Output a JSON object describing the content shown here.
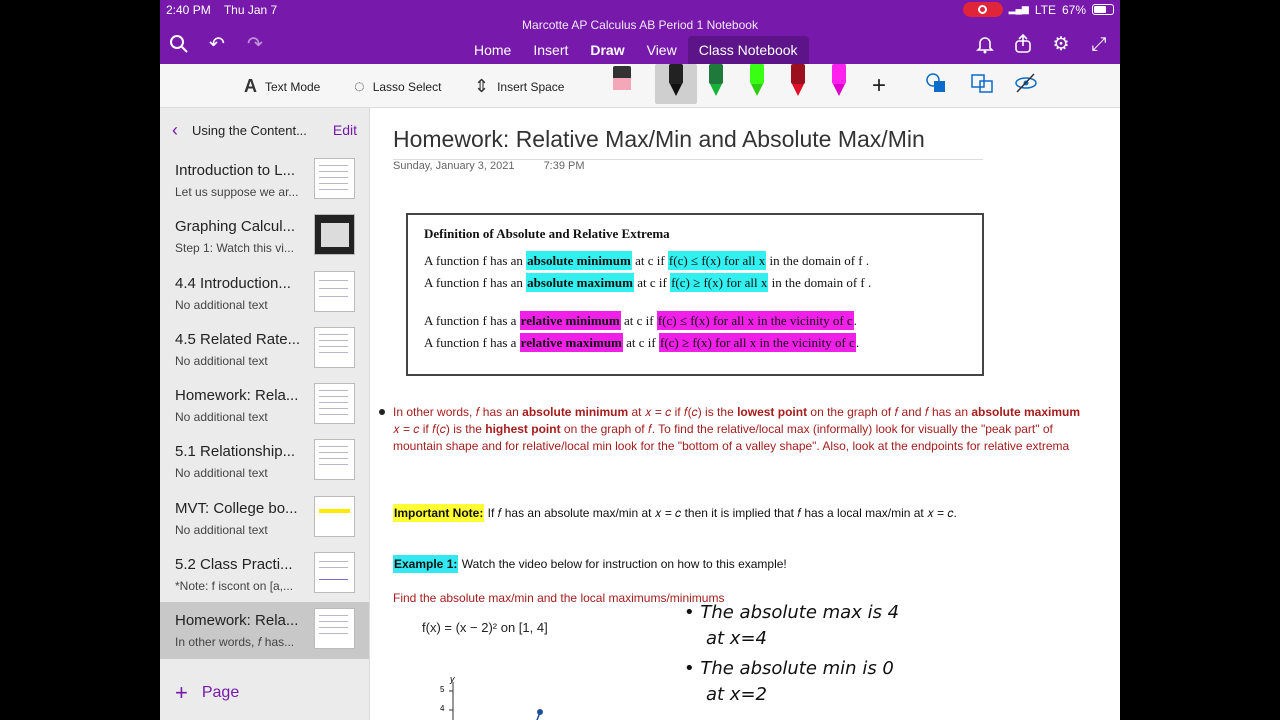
{
  "status": {
    "time": "2:40 PM",
    "date": "Thu Jan 7",
    "network": "LTE",
    "battery": "67%"
  },
  "app": {
    "notebook_title": "Marcotte AP Calculus AB Period 1 Notebook"
  },
  "tabs": [
    "Home",
    "Insert",
    "Draw",
    "View",
    "Class Notebook"
  ],
  "ribbon": {
    "text_mode": "Text Mode",
    "lasso": "Lasso Select",
    "insert_space": "Insert Space"
  },
  "sidebar": {
    "section": "Using the Content...",
    "edit": "Edit",
    "add_page": "Page",
    "items": [
      {
        "title": "Introduction to L...",
        "sub": "Let us suppose we ar..."
      },
      {
        "title": "Graphing Calcul...",
        "sub": "Step 1: Watch this vi..."
      },
      {
        "title": "4.4 Introduction...",
        "sub": "No additional text"
      },
      {
        "title": "4.5 Related Rate...",
        "sub": "No additional text"
      },
      {
        "title": "Homework: Rela...",
        "sub": "No additional text"
      },
      {
        "title": "5.1 Relationship...",
        "sub": "No additional text"
      },
      {
        "title": "MVT: College bo...",
        "sub": "No additional text"
      },
      {
        "title": "5.2 Class Practi...",
        "sub": "*Note: f iscont on [a,..."
      },
      {
        "title": "Homework: Rela...",
        "sub": "In other words, 𝑓 has..."
      }
    ]
  },
  "page": {
    "title": "Homework: Relative Max/Min and Absolute Max/Min",
    "date": "Sunday, January 3, 2021",
    "time": "7:39 PM",
    "def_heading": "Definition of Absolute and Relative Extrema",
    "def": {
      "l1a": "A function  f  has an ",
      "l1b": "absolute minimum",
      "l1c": " at  c  if ",
      "l1d": "f(c) ≤ f(x)  for all  x",
      "l1e": " in the domain of  f .",
      "l2a": "A function  f  has an ",
      "l2b": "absolute maximum",
      "l2c": " at  c  if ",
      "l2d": "f(c) ≥ f(x)  for all  x",
      "l2e": " in the domain of  f .",
      "l3a": "A function  f  has a ",
      "l3b": "relative minimum",
      "l3c": " at  c  if ",
      "l3d": "f(c) ≤ f(x)  for all  x in the vicinity of  c",
      "l3e": ".",
      "l4a": "A function  f  has a ",
      "l4b": "relative maximum",
      "l4c": " at  c  if ",
      "l4d": "f(c) ≥ f(x)  for all  x in the vicinity of  c",
      "l4e": "."
    },
    "para1": "In other words, 𝑓 has an ",
    "para1_b1": "absolute minimum",
    "para1_2": " at 𝑥 = 𝑐 if 𝑓(𝑐) is the ",
    "para1_b2": "lowest point",
    "para1_3": " on the graph of 𝑓 and 𝑓 has an ",
    "para1_b3": "absolute maximum",
    "para2": " 𝑥 = 𝑐 if 𝑓(𝑐) is the ",
    "para2_b": "highest point",
    "para2_2": " on the graph of 𝑓.  To find the relative/local max (informally) look for visually the \"peak part\" of",
    "para3": "mountain shape and for relative/local min look for the \"bottom of a valley shape\". Also, look at the endpoints for relative extrema",
    "note_label": "Important Note:",
    "note_text": " If 𝑓 has an absolute max/min at 𝑥 = 𝑐 then it is implied that 𝑓 has a local max/min at 𝑥 = 𝑐.",
    "ex_label": "Example 1:",
    "ex_text": " Watch the video below for instruction on how to this example!",
    "find": "Find the absolute max/min and the local maximums/minimums",
    "fx": "f(x) = (x − 2)² on [1, 4]",
    "hand1": "• The absolute max is 4",
    "hand2": "at x=4",
    "hand3": "• The absolute min is 0",
    "hand4": "at x=2",
    "y_tick5": "5",
    "y_tick4": "4",
    "y_label": "y"
  }
}
